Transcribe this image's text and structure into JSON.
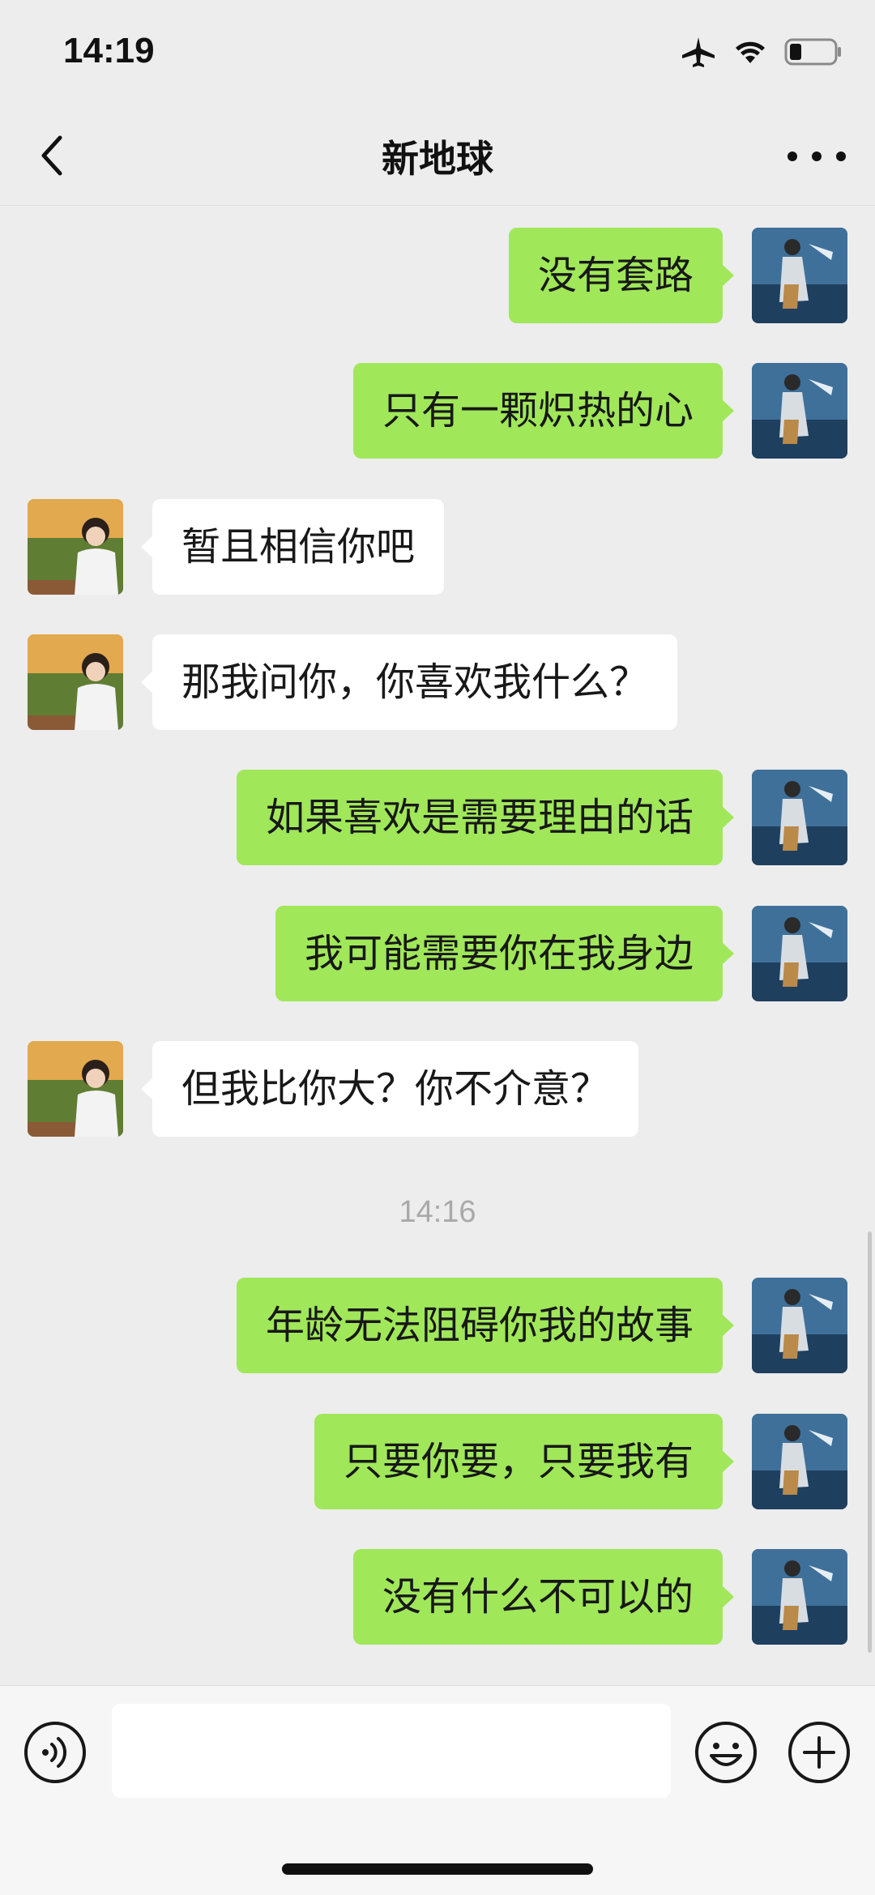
{
  "status": {
    "time": "14:19"
  },
  "nav": {
    "title": "新地球"
  },
  "messages": [
    {
      "side": "me",
      "text": "没有套路"
    },
    {
      "side": "me",
      "text": "只有一颗炽热的心"
    },
    {
      "side": "them",
      "text": "暂且相信你吧"
    },
    {
      "side": "them",
      "text": "那我问你，你喜欢我什么？"
    },
    {
      "side": "me",
      "text": "如果喜欢是需要理由的话"
    },
    {
      "side": "me",
      "text": "我可能需要你在我身边"
    },
    {
      "side": "them",
      "text": "但我比你大？你不介意？"
    },
    {
      "side": "me",
      "text": "年龄无法阻碍你我的故事"
    },
    {
      "side": "me",
      "text": "只要你要，只要我有"
    },
    {
      "side": "me",
      "text": "没有什么不可以的"
    }
  ],
  "timestamp": "14:16",
  "input": {
    "value": ""
  },
  "icons": {
    "back": "chevron-left-icon",
    "more": "more-dots-icon",
    "voice": "voice-icon",
    "emoji": "emoji-icon",
    "plus": "plus-icon"
  },
  "colors": {
    "bubble_me": "#a0e75a",
    "bubble_them": "#ffffff",
    "background": "#ededed"
  }
}
